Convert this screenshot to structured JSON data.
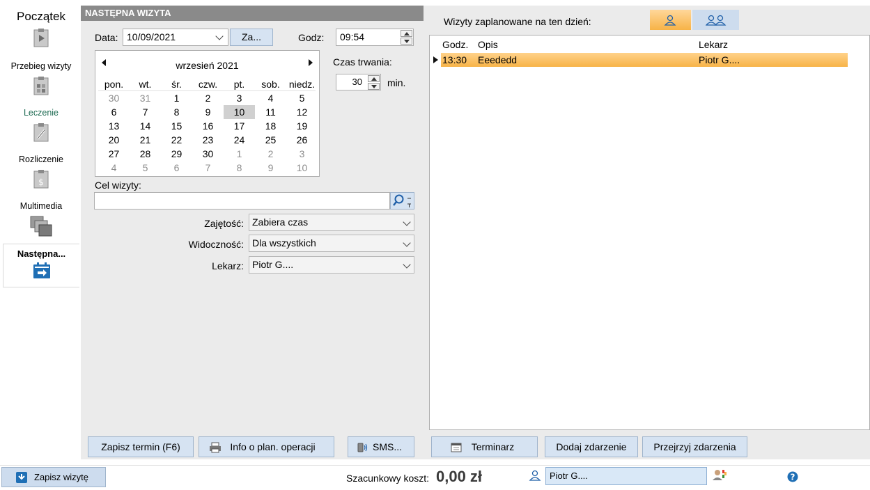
{
  "nav": {
    "items": [
      {
        "label": "Początek",
        "icon": "document-play-icon"
      },
      {
        "label": "Przebieg wizyty",
        "icon": "clipboard-grid-icon"
      },
      {
        "label": "Leczenie",
        "icon": "clipboard-syringe-icon"
      },
      {
        "label": "Rozliczenie",
        "icon": "clipboard-dollar-icon"
      },
      {
        "label": "Multimedia",
        "icon": "images-stack-icon"
      },
      {
        "label": "Następna...",
        "icon": "calendar-arrow-icon"
      }
    ]
  },
  "visit": {
    "header": "NASTĘPNA WIZYTA",
    "date_label": "Data:",
    "date_value": "10/09/2021",
    "za_button": "Za...",
    "time_label": "Godz:",
    "time_value": "09:54",
    "duration_label": "Czas trwania:",
    "duration_value": "30",
    "duration_unit": "min.",
    "purpose_label": "Cel wizyty:",
    "purpose_value": "",
    "occupancy_label": "Zajętość:",
    "occupancy_value": "Zabiera czas",
    "visibility_label": "Widoczność:",
    "visibility_value": "Dla wszystkich",
    "doctor_label": "Lekarz:",
    "doctor_value": "Piotr G...."
  },
  "calendar": {
    "month": "wrzesień 2021",
    "weekdays": [
      "pon.",
      "wt.",
      "śr.",
      "czw.",
      "pt.",
      "sob.",
      "niedz."
    ],
    "weeks": [
      [
        "30",
        "31",
        "1",
        "2",
        "3",
        "4",
        "5"
      ],
      [
        "6",
        "7",
        "8",
        "9",
        "10",
        "11",
        "12"
      ],
      [
        "13",
        "14",
        "15",
        "16",
        "17",
        "18",
        "19"
      ],
      [
        "20",
        "21",
        "22",
        "23",
        "24",
        "25",
        "26"
      ],
      [
        "27",
        "28",
        "29",
        "30",
        "1",
        "2",
        "3"
      ],
      [
        "4",
        "5",
        "6",
        "7",
        "8",
        "9",
        "10"
      ]
    ],
    "selected": "10"
  },
  "buttons": {
    "save_term": "Zapisz termin (F6)",
    "info_plan": "Info o plan. operacji",
    "sms": "SMS...",
    "schedule": "Terminarz",
    "add_event": "Dodaj zdarzenie",
    "view_events": "Przejrzyj zdarzenia",
    "save_visit": "Zapisz wizytę"
  },
  "day_visits": {
    "title": "Wizyty zaplanowane na ten dzień:",
    "columns": [
      "Godz.",
      "Opis",
      "Lekarz"
    ],
    "rows": [
      {
        "time": "13:30",
        "desc": "Eeededd",
        "doctor": "Piotr G...."
      }
    ]
  },
  "footer": {
    "cost_label": "Szacunkowy koszt:",
    "cost_value": "0,00 zł",
    "doctor_value": "Piotr G...."
  },
  "colors": {
    "accent_orange": "#f7b347",
    "button_blue": "#d6e3f2",
    "active_icon_blue": "#1f6fb5"
  }
}
